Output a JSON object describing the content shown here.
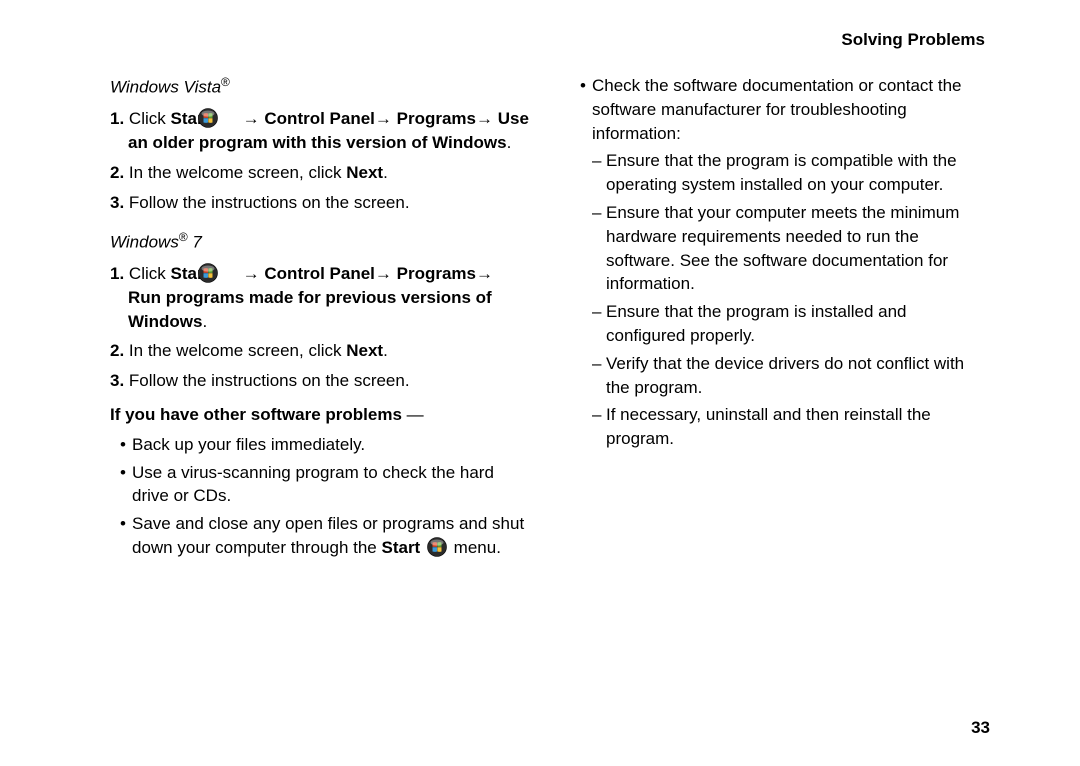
{
  "header": "Solving Problems",
  "left": {
    "vista_head": "Windows Vista",
    "vista_reg": "®",
    "step1_click": "Click ",
    "step1_start": "Start",
    "step1_rest": " → Control Panel→ Programs→ Use an older program with this version of Windows",
    "step2_a": "In the welcome screen, click ",
    "step2_b": "Next",
    "step3": "Follow the instructions on the screen.",
    "win7_head_a": "Windows",
    "win7_head_b": " 7",
    "w7_step1_rest": " → Control Panel→ Programs→ Run programs made for previous versions of Windows",
    "other_lead": "If you have other software problems",
    "other_dash": " —",
    "b1": "Back up your files immediately.",
    "b2": "Use a virus-scanning program to check the hard drive or CDs.",
    "b3a": "Save and close any open files or programs and shut down your computer through the ",
    "b3b": "Start",
    "b3c": "  menu."
  },
  "right": {
    "b4": "Check the software documentation or contact the software manufacturer for troubleshooting information:",
    "d1": "Ensure that the program is compatible with the operating system installed on your computer.",
    "d2": "Ensure that your computer meets the minimum hardware requirements needed to run the software. See the software documentation for information.",
    "d3": "Ensure that the program is installed and configured properly.",
    "d4": "Verify that the device drivers do not conflict with the program.",
    "d5": "If necessary, uninstall and then reinstall the program."
  },
  "page_number": "33"
}
